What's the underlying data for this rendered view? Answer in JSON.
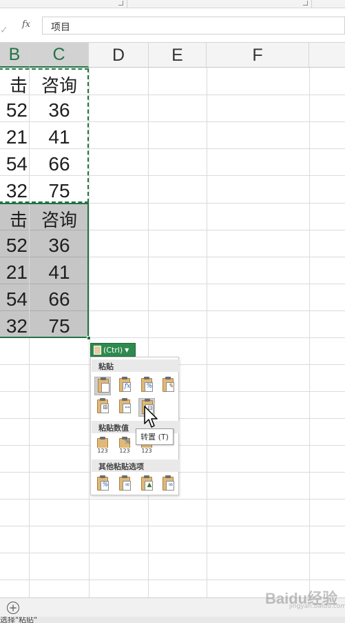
{
  "formula_bar": {
    "fx_label": "fx",
    "value": "项目"
  },
  "columns": [
    "B",
    "C",
    "D",
    "E",
    "F"
  ],
  "cells": {
    "b": [
      "击",
      "52",
      "21",
      "54",
      "32",
      "击",
      "52",
      "21",
      "54",
      "32"
    ],
    "c": [
      "咨询",
      "36",
      "41",
      "66",
      "75",
      "咨询",
      "36",
      "41",
      "66",
      "75"
    ]
  },
  "paste_button": {
    "label": "(Ctrl)",
    "icon": "clipboard-icon"
  },
  "paste_menu": {
    "section_paste": "粘贴",
    "section_values": "粘贴数值",
    "section_other": "其他粘贴选项",
    "value_icon_label": "123"
  },
  "tooltip": "转置 (T)",
  "sheet_bar": {
    "add_sheet_icon": "plus-circle-icon"
  },
  "status": {
    "text": "选择\"粘贴\""
  },
  "watermark": {
    "text": "Baidu经验",
    "sub": "jingyan.baidu.com"
  },
  "colors": {
    "accent": "#217346",
    "selection_fill": "#c6c6c6",
    "clipboard": "#e0b878"
  }
}
